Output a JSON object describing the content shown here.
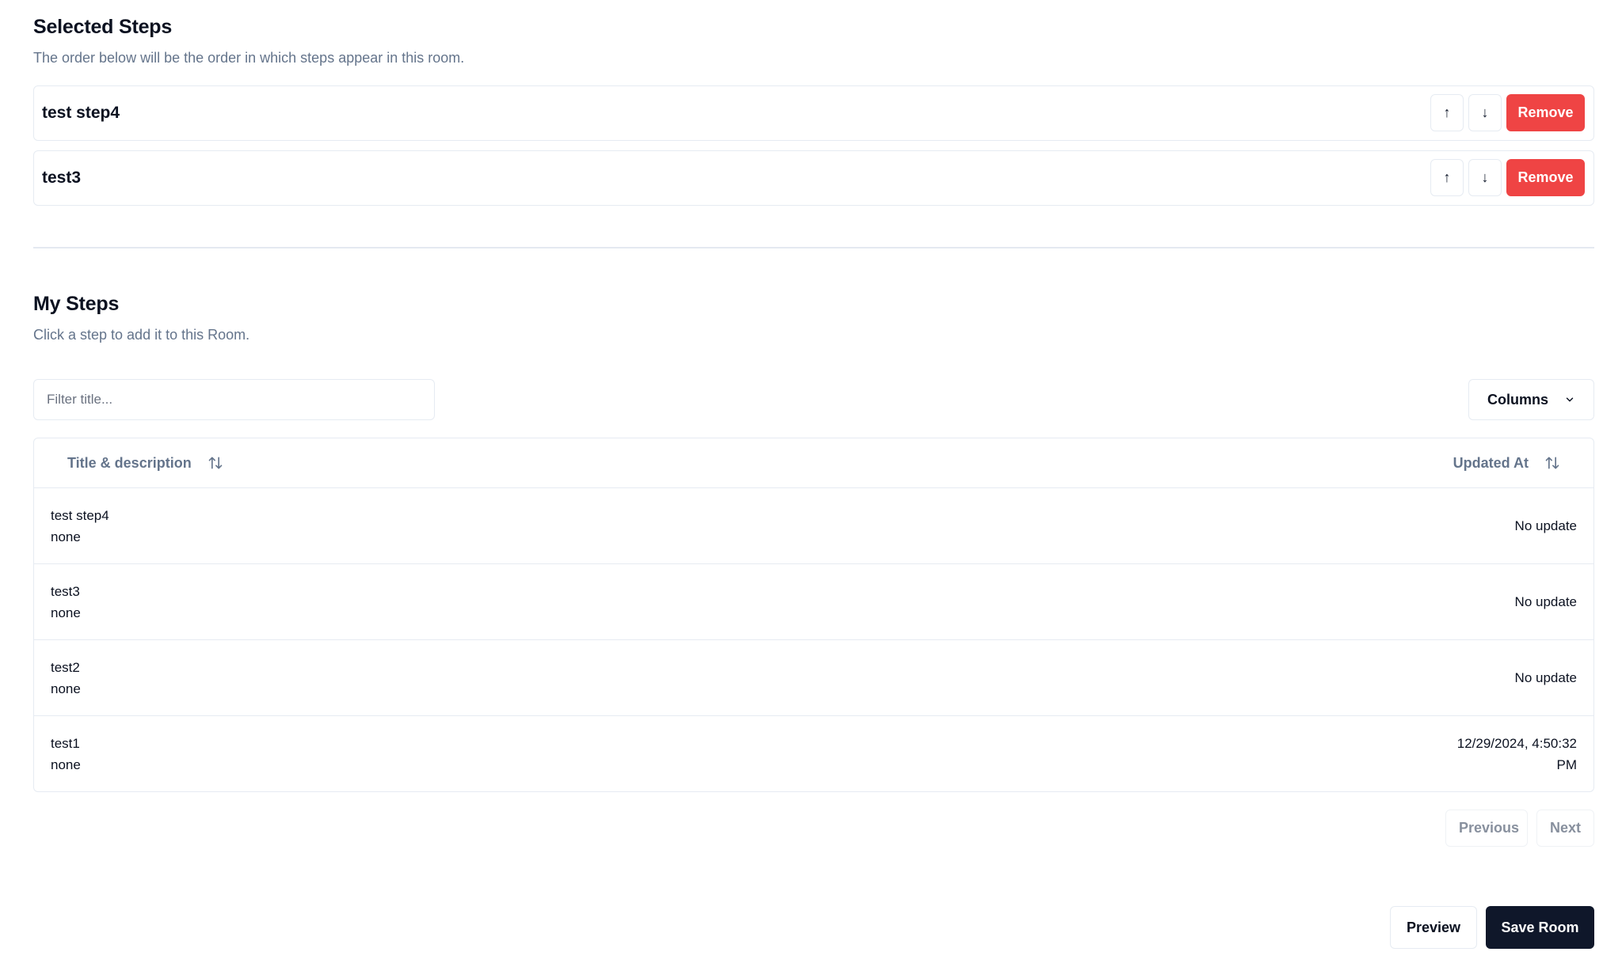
{
  "selected": {
    "title": "Selected Steps",
    "subtitle": "The order below will be the order in which steps appear in this room.",
    "steps": [
      {
        "name": "test step4",
        "up_label": "↑",
        "down_label": "↓",
        "remove_label": "Remove"
      },
      {
        "name": "test3",
        "up_label": "↑",
        "down_label": "↓",
        "remove_label": "Remove"
      }
    ]
  },
  "my_steps": {
    "title": "My Steps",
    "subtitle": "Click a step to add it to this Room.",
    "filter": {
      "placeholder": "Filter title...",
      "value": ""
    },
    "columns_label": "Columns",
    "table": {
      "headers": [
        "Title & description",
        "Updated At"
      ],
      "rows": [
        {
          "title": "test step4",
          "description": "none",
          "updated_at": "No update"
        },
        {
          "title": "test3",
          "description": "none",
          "updated_at": "No update"
        },
        {
          "title": "test2",
          "description": "none",
          "updated_at": "No update"
        },
        {
          "title": "test1",
          "description": "none",
          "updated_at": "12/29/2024, 4:50:32 PM"
        }
      ]
    },
    "pagination": {
      "previous_label": "Previous",
      "next_label": "Next"
    }
  },
  "footer": {
    "preview_label": "Preview",
    "save_label": "Save Room"
  },
  "colors": {
    "danger": "#ef4444",
    "primary": "#0f172a",
    "muted_text": "#64748b",
    "border": "#e6ebf2"
  }
}
